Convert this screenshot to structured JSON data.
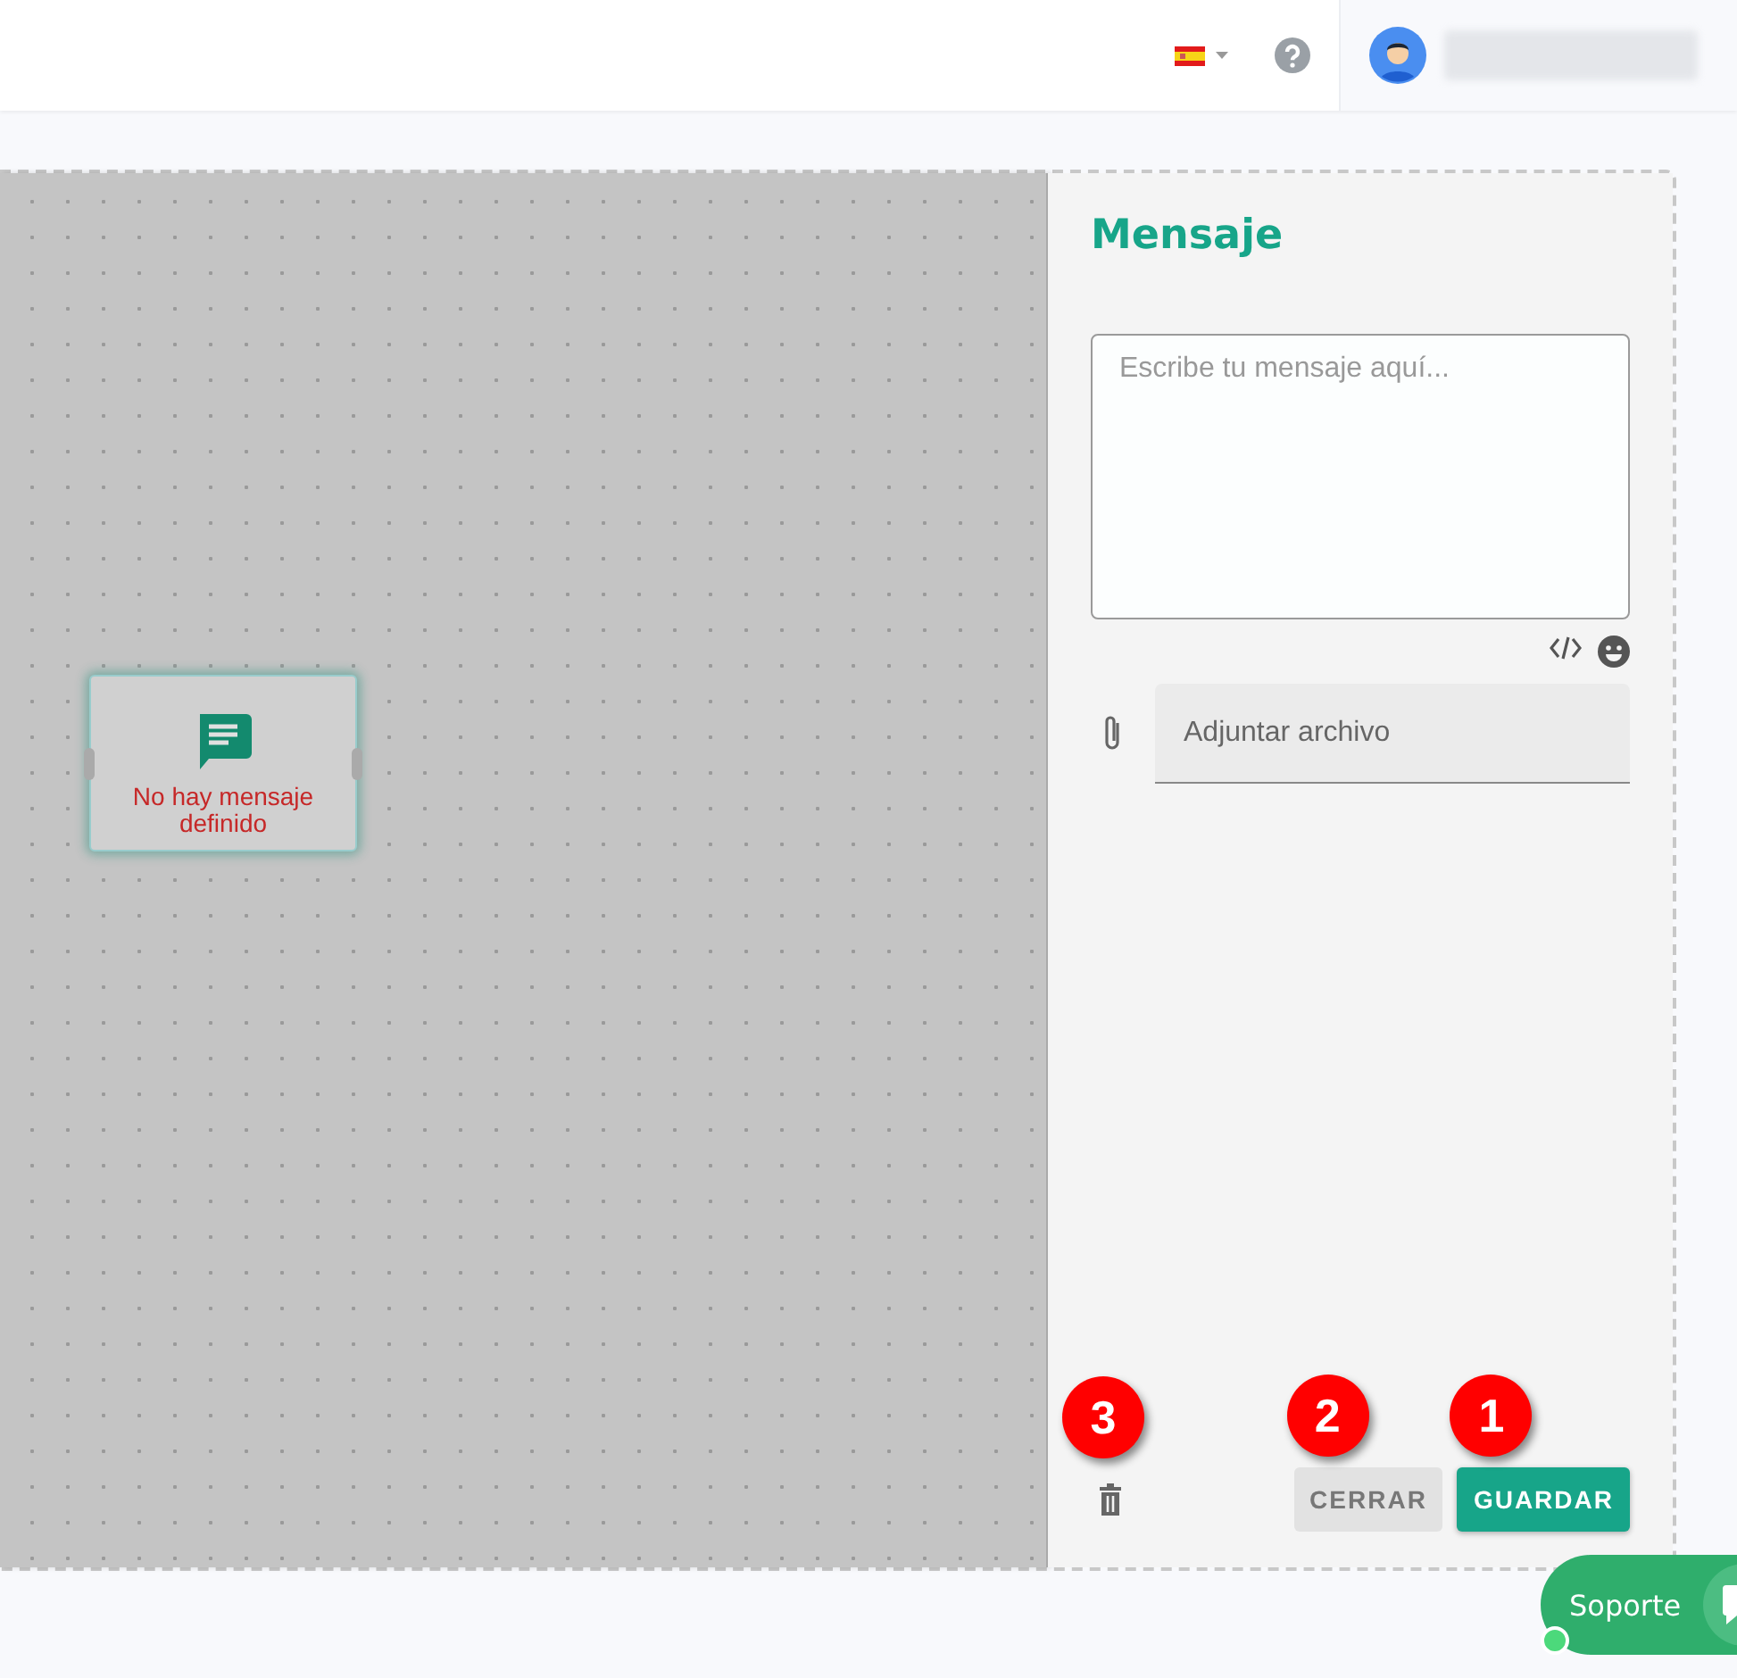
{
  "node": {
    "label": "No hay mensaje definido"
  },
  "panel": {
    "title": "Mensaje",
    "message": {
      "placeholder": "Escribe tu mensaje aquí..."
    },
    "attachment": {
      "placeholder": "Adjuntar archivo"
    },
    "delete_callout": "3",
    "buttons": [
      {
        "label": "CERRAR",
        "kind": "secondary",
        "callout": "2"
      },
      {
        "label": "GUARDAR",
        "kind": "primary",
        "callout": "1"
      }
    ]
  },
  "support": {
    "label": "Soporte",
    "online": true
  }
}
